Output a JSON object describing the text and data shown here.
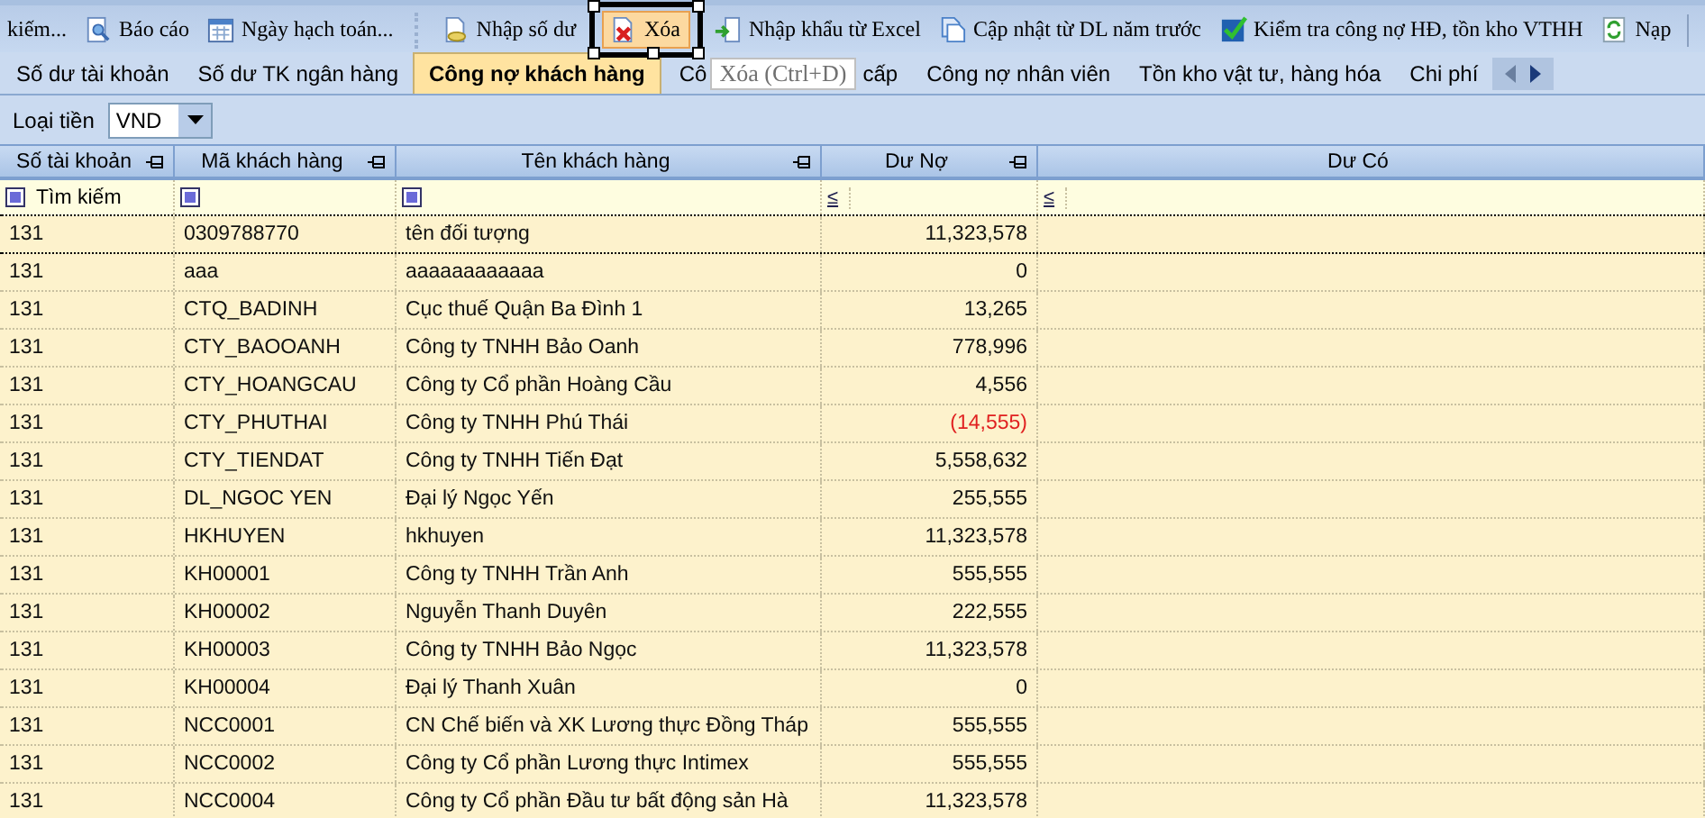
{
  "toolbar": [
    {
      "label": "kiếm...",
      "selected": false
    },
    {
      "label": "Báo cáo",
      "selected": false
    },
    {
      "label": "Ngày hạch toán...",
      "selected": false
    },
    {
      "label": "Nhập số dư",
      "selected": false,
      "separator_before": true
    },
    {
      "label": "Xóa",
      "selected": true
    },
    {
      "label": "Nhập khẩu từ Excel",
      "selected": false
    },
    {
      "label": "Cập nhật từ DL năm trước",
      "selected": false
    },
    {
      "label": "Kiểm tra công nợ HĐ, tồn kho VTHH",
      "selected": false
    },
    {
      "label": "Nạp",
      "selected": false
    }
  ],
  "tooltip": "Xóa (Ctrl+D)",
  "tabs": [
    {
      "label": "Số dư tài khoản",
      "selected": false
    },
    {
      "label": "Số dư TK ngân hàng",
      "selected": false
    },
    {
      "label": "Công nợ khách hàng",
      "selected": true
    },
    {
      "label": "Cô",
      "label_end": "cấp",
      "selected": false
    },
    {
      "label": "Công nợ nhân viên",
      "selected": false
    },
    {
      "label": "Tồn kho vật tư, hàng hóa",
      "selected": false
    },
    {
      "label": "Chi phí",
      "selected": false
    }
  ],
  "currency": {
    "label": "Loại tiền",
    "value": "VND"
  },
  "table": {
    "columns": [
      {
        "label": "Số tài khoản",
        "pinned": true
      },
      {
        "label": "Mã khách hàng",
        "pinned": true
      },
      {
        "label": "Tên khách hàng",
        "pinned": true
      },
      {
        "label": "Dư Nợ",
        "pinned": true
      },
      {
        "label": "Dư Có",
        "pinned": false
      }
    ],
    "filter_row": [
      {
        "kind": "check",
        "text": "Tìm kiếm"
      },
      {
        "kind": "check"
      },
      {
        "kind": "check"
      },
      {
        "kind": "compare",
        "text": "≤"
      },
      {
        "kind": "compare",
        "text": "≤"
      }
    ],
    "rows": [
      {
        "account": "131",
        "code": "0309788770",
        "name": "tên đối tượng",
        "debit": "11,323,578",
        "negative": false
      },
      {
        "account": "131",
        "code": "aaa",
        "name": "aaaaaaaaaaaa",
        "debit": "0",
        "negative": false
      },
      {
        "account": "131",
        "code": "CTQ_BADINH",
        "name": "Cục thuế Quận Ba Đình 1",
        "debit": "13,265",
        "negative": false
      },
      {
        "account": "131",
        "code": "CTY_BAOOANH",
        "name": "Công ty TNHH Bảo Oanh",
        "debit": "778,996",
        "negative": false
      },
      {
        "account": "131",
        "code": "CTY_HOANGCAU",
        "name": "Công ty Cổ phần Hoàng Cầu",
        "debit": "4,556",
        "negative": false
      },
      {
        "account": "131",
        "code": "CTY_PHUTHAI",
        "name": "Công ty TNHH Phú Thái",
        "debit": "(14,555)",
        "negative": true
      },
      {
        "account": "131",
        "code": "CTY_TIENDAT",
        "name": "Công ty TNHH Tiến Đạt",
        "debit": "5,558,632",
        "negative": false
      },
      {
        "account": "131",
        "code": "DL_NGOC YEN",
        "name": "Đại lý Ngọc Yến",
        "debit": "255,555",
        "negative": false
      },
      {
        "account": "131",
        "code": "HKHUYEN",
        "name": "hkhuyen",
        "debit": "11,323,578",
        "negative": false
      },
      {
        "account": "131",
        "code": "KH00001",
        "name": "Công ty TNHH Trần Anh",
        "debit": "555,555",
        "negative": false
      },
      {
        "account": "131",
        "code": "KH00002",
        "name": "Nguyễn Thanh Duyên",
        "debit": "222,555",
        "negative": false
      },
      {
        "account": "131",
        "code": "KH00003",
        "name": "Công ty TNHH Bảo Ngọc",
        "debit": "11,323,578",
        "negative": false
      },
      {
        "account": "131",
        "code": "KH00004",
        "name": "Đại lý Thanh Xuân",
        "debit": "0",
        "negative": false
      },
      {
        "account": "131",
        "code": "NCC0001",
        "name": "CN Chế biến và XK Lương thực Đồng Tháp",
        "debit": "555,555",
        "negative": false
      },
      {
        "account": "131",
        "code": "NCC0002",
        "name": "Công ty Cổ phần Lương thực Intimex",
        "debit": "555,555",
        "negative": false
      },
      {
        "account": "131",
        "code": "NCC0004",
        "name": "Công ty Cổ phần Đầu tư bất động sản Hà",
        "debit": "11,323,578",
        "negative": false
      }
    ]
  }
}
